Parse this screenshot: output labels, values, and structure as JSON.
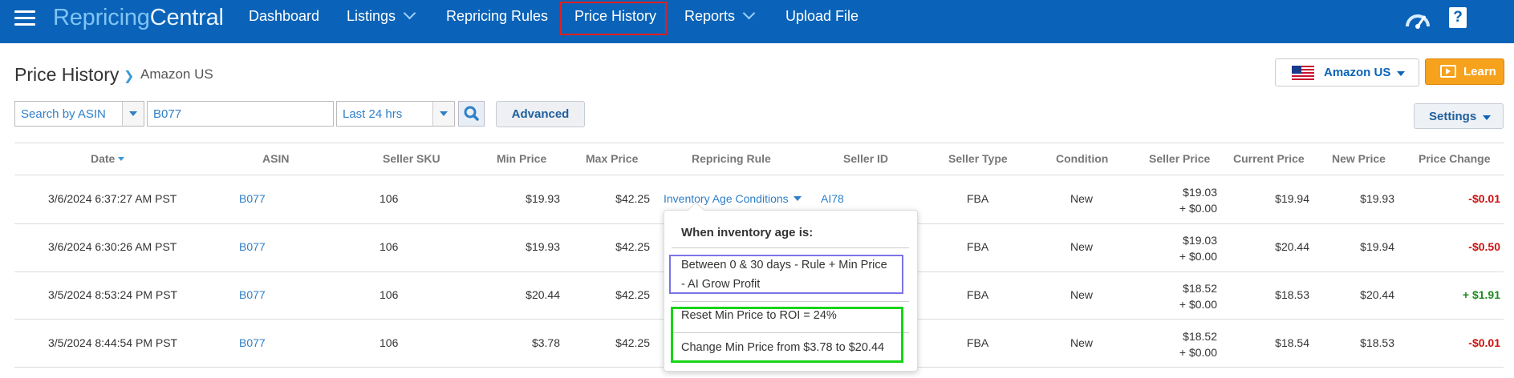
{
  "nav": {
    "logo_a": "Repricing",
    "logo_b": "Central",
    "items": [
      {
        "label": "Dashboard"
      },
      {
        "label": "Listings"
      },
      {
        "label": "Repricing Rules"
      },
      {
        "label": "Price History"
      },
      {
        "label": "Reports"
      },
      {
        "label": "Upload File"
      }
    ],
    "icons": [
      "hamburger-icon",
      "speedometer-icon",
      "help-icon"
    ],
    "help_glyph": "?"
  },
  "header": {
    "title": "Price History",
    "breadcrumb": "Amazon US",
    "marketplace": "Amazon US",
    "learn": "Learn"
  },
  "search": {
    "type": "Search by ASIN",
    "query": "B077",
    "range": "Last 24 hrs",
    "advanced": "Advanced",
    "settings": "Settings"
  },
  "table": {
    "columns": [
      "Date",
      "ASIN",
      "Seller SKU",
      "Min Price",
      "Max Price",
      "Repricing Rule",
      "Seller ID",
      "Seller Type",
      "Condition",
      "Seller Price",
      "Current Price",
      "New Price",
      "Price Change"
    ],
    "rows": [
      {
        "date": "3/6/2024 6:37:27 AM PST",
        "asin": "B077",
        "sku": "106",
        "min": "$19.93",
        "max": "$42.25",
        "rule": "Inventory Age Conditions",
        "seller_id": "AI78",
        "seller_type": "FBA",
        "condition": "New",
        "seller_price": "$19.03",
        "shipping": "+ $0.00",
        "current": "$19.94",
        "new": "$19.93",
        "change": "-$0.01"
      },
      {
        "date": "3/6/2024 6:30:26 AM PST",
        "asin": "B077",
        "sku": "106",
        "min": "$19.93",
        "max": "$42.25",
        "rule": "",
        "seller_id": "",
        "seller_type": "FBA",
        "condition": "New",
        "seller_price": "$19.03",
        "shipping": "+ $0.00",
        "current": "$20.44",
        "new": "$19.94",
        "change": "-$0.50"
      },
      {
        "date": "3/5/2024 8:53:24 PM PST",
        "asin": "B077",
        "sku": "106",
        "min": "$20.44",
        "max": "$42.25",
        "rule": "",
        "seller_id": "",
        "seller_type": "FBA",
        "condition": "New",
        "seller_price": "$18.52",
        "shipping": "+ $0.00",
        "current": "$18.53",
        "new": "$20.44",
        "change": "+ $1.91"
      },
      {
        "date": "3/5/2024 8:44:54 PM PST",
        "asin": "B077",
        "sku": "106",
        "min": "$3.78",
        "max": "$42.25",
        "rule": "",
        "seller_id": "",
        "seller_type": "FBA",
        "condition": "New",
        "seller_price": "$18.52",
        "shipping": "+ $0.00",
        "current": "$18.54",
        "new": "$18.53",
        "change": "-$0.01"
      }
    ]
  },
  "popover": {
    "title": "When inventory age is:",
    "line1": "Between 0 & 30 days - Rule + Min Price",
    "line2": "- AI Grow Profit",
    "line3": "Reset Min Price to ROI = 24%",
    "line4": "Change Min Price from $3.78 to $20.44"
  },
  "colors": {
    "nav_bg": "#0a63b8",
    "highlight_red": "#e01f1f",
    "highlight_purple": "#7b73e6",
    "highlight_green": "#18d418",
    "learn_bg": "#f7a21c",
    "negative": "#cc1111",
    "positive": "#1e8b1e"
  }
}
